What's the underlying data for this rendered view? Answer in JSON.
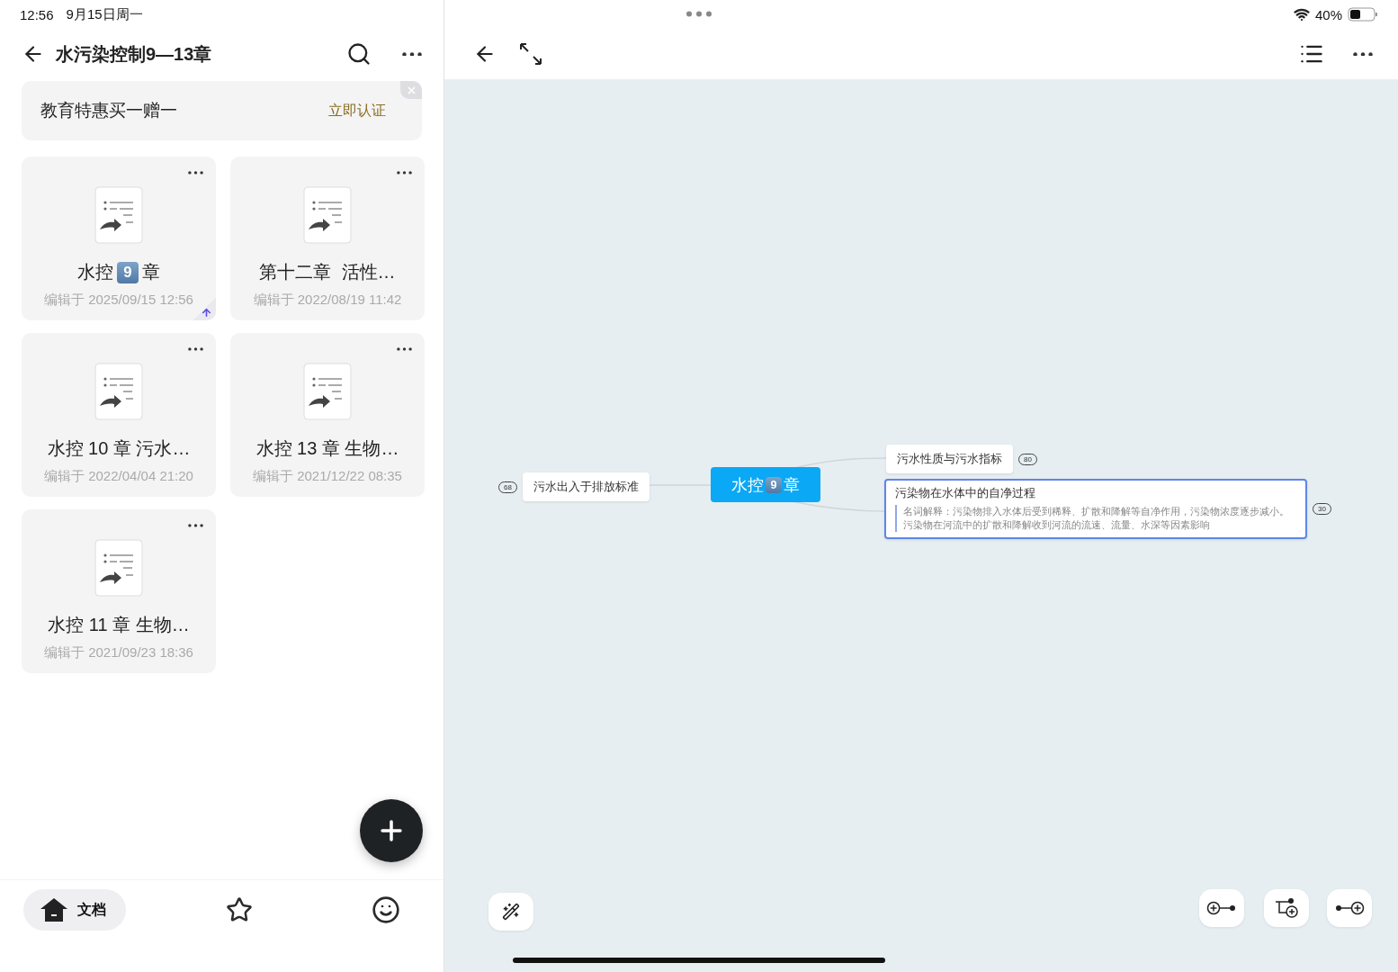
{
  "status_bar": {
    "time": "12:56",
    "date": "9月15日周一",
    "battery": "40%"
  },
  "header": {
    "title": "水污染控制9—13章"
  },
  "promo": {
    "text": "教育特惠买一赠一",
    "action": "立即认证"
  },
  "documents": [
    {
      "title": [
        {
          "kind": "plain",
          "text": "水控"
        },
        {
          "kind": "keycap",
          "text": "9"
        },
        {
          "kind": "plain",
          "text": "章"
        }
      ],
      "edited": "编辑于 2025/09/15 12:56",
      "upload_pending": true
    },
    {
      "title": [
        {
          "kind": "plain",
          "text": "第十二章  活性…"
        }
      ],
      "edited": "编辑于 2022/08/19 11:42",
      "upload_pending": false
    },
    {
      "title": [
        {
          "kind": "plain",
          "text": "水控 10 章 污水…"
        }
      ],
      "edited": "编辑于 2022/04/04 21:20",
      "upload_pending": false
    },
    {
      "title": [
        {
          "kind": "plain",
          "text": "水控 13 章 生物…"
        }
      ],
      "edited": "编辑于 2021/12/22 08:35",
      "upload_pending": false
    },
    {
      "title": [
        {
          "kind": "plain",
          "text": "水控 11 章 生物…"
        }
      ],
      "edited": "编辑于 2021/09/23 18:36",
      "upload_pending": false
    }
  ],
  "bottom_tabs": [
    {
      "kind": "home",
      "label": "文档",
      "selected": true
    },
    {
      "kind": "favorites",
      "selected": false
    },
    {
      "kind": "profile",
      "selected": false
    }
  ],
  "mind_map": {
    "root": {
      "title": [
        {
          "kind": "plain",
          "text": "水控"
        },
        {
          "kind": "keycap",
          "text": "9"
        },
        {
          "kind": "plain",
          "text": "章"
        }
      ]
    },
    "nodes": [
      {
        "kind": "left",
        "title": "污水出入于排放标准",
        "count": "68",
        "selected": false
      },
      {
        "kind": "right",
        "title": "污水性质与污水指标",
        "count": "80",
        "selected": false
      },
      {
        "kind": "right",
        "title": "污染物在水体中的自净过程",
        "note": "名词解释：污染物排入水体后受到稀释、扩散和降解等自净作用，污染物浓度逐步减小。污染物在河流中的扩散和降解收到河流的流速、流量、水深等因素影响",
        "count": "30",
        "selected": true
      }
    ]
  }
}
